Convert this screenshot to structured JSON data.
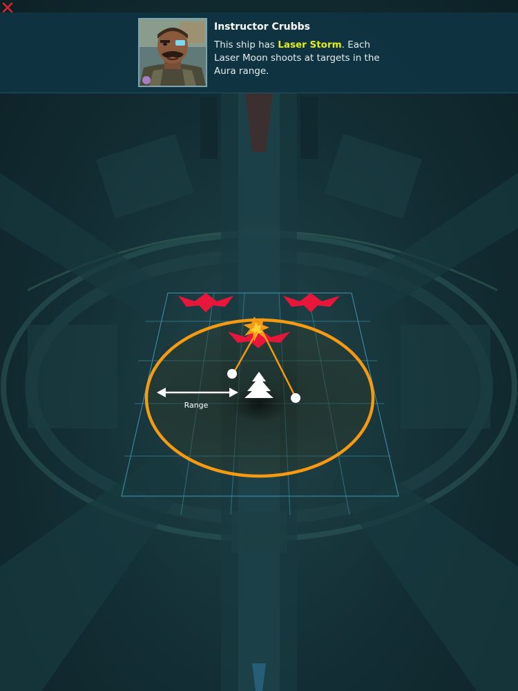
{
  "close_button": {
    "icon": "close-icon",
    "color": "#e0242b"
  },
  "tutorial": {
    "speaker": "Instructor Crubbs",
    "portrait_icon": "instructor-crubbs-portrait",
    "text_before": "This ship has ",
    "highlight": "Laser Storm",
    "text_after": ". Each Laser Moon shoots at targets in the Aura range.",
    "highlight_color": "#e8f00d"
  },
  "diagram": {
    "range_label": "Range",
    "aura_color": "#f59a12",
    "enemy_color": "#e8163a",
    "laser_color": "#f59a12",
    "grid_color": "#4fb6d8",
    "player_ship_icon": "player-ship-icon",
    "laser_moon_icon": "laser-moon-icon",
    "enemy_icon": "enemy-ship-icon",
    "impact_icon": "explosion-icon"
  }
}
